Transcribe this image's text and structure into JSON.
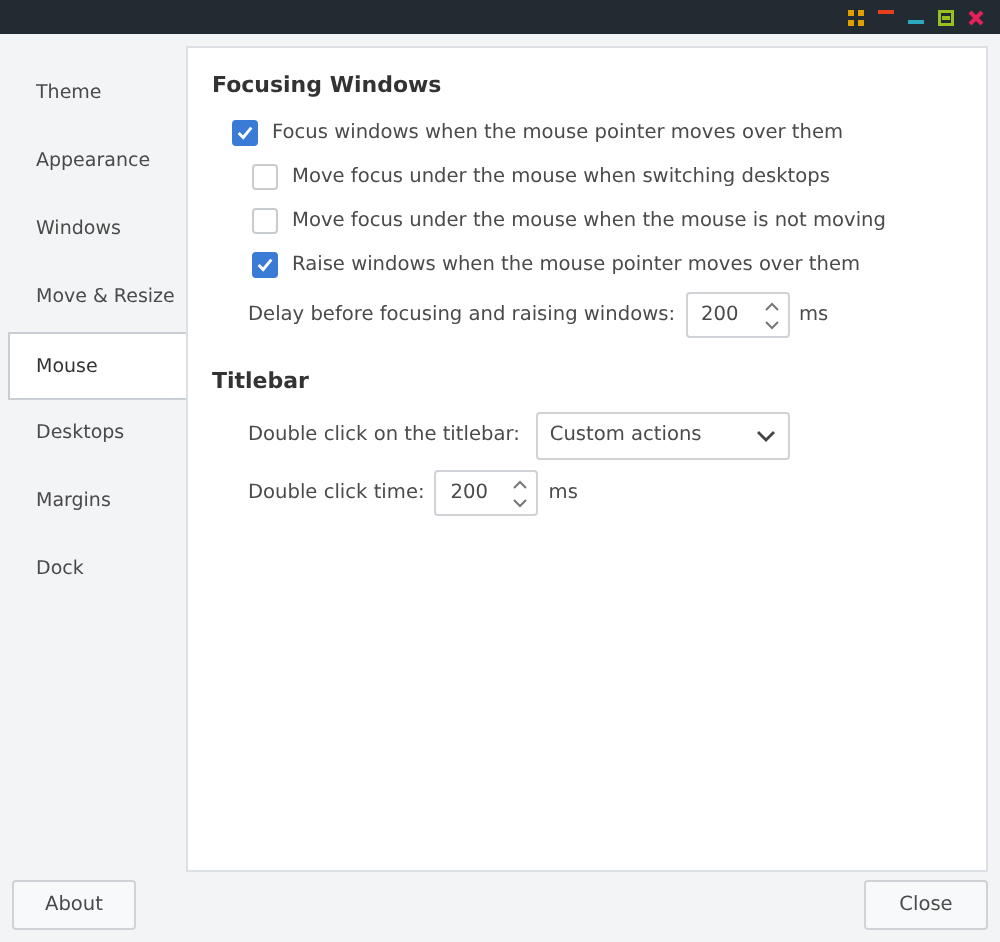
{
  "sidebar": {
    "items": [
      {
        "label": "Theme",
        "selected": false
      },
      {
        "label": "Appearance",
        "selected": false
      },
      {
        "label": "Windows",
        "selected": false
      },
      {
        "label": "Move & Resize",
        "selected": false
      },
      {
        "label": "Mouse",
        "selected": true
      },
      {
        "label": "Desktops",
        "selected": false
      },
      {
        "label": "Margins",
        "selected": false
      },
      {
        "label": "Dock",
        "selected": false
      }
    ]
  },
  "focusing": {
    "heading": "Focusing Windows",
    "options": [
      {
        "label": "Focus windows when the mouse pointer moves over them",
        "checked": true,
        "children": [
          {
            "label": "Move focus under the mouse when switching desktops",
            "checked": false
          },
          {
            "label": "Move focus under the mouse when the mouse is not moving",
            "checked": false
          },
          {
            "label": "Raise windows when the mouse pointer moves over them",
            "checked": true
          }
        ]
      }
    ],
    "delay": {
      "label": "Delay before focusing and raising windows:",
      "value": "200",
      "unit": "ms"
    }
  },
  "titlebar": {
    "heading": "Titlebar",
    "double_click": {
      "label": "Double click on the titlebar:",
      "value": "Custom actions"
    },
    "double_click_time": {
      "label": "Double click time:",
      "value": "200",
      "unit": "ms"
    }
  },
  "buttons": {
    "about": "About",
    "close": "Close"
  }
}
